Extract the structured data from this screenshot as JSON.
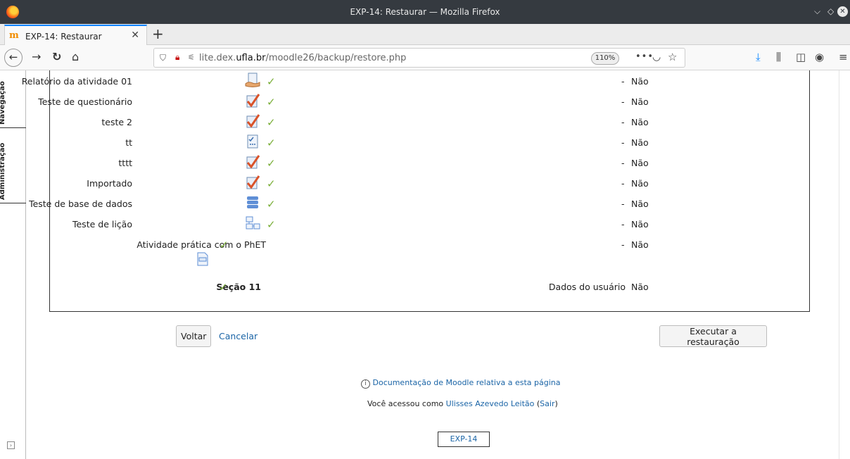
{
  "window": {
    "title": "EXP-14: Restaurar — Mozilla Firefox"
  },
  "browser": {
    "tab_title": "EXP-14: Restaurar",
    "tab_favicon": "m",
    "url_prefix": "lite.dex.",
    "url_domain": "ufla.br",
    "url_path": "/moodle26/backup/restore.php",
    "zoom": "110%"
  },
  "drawer": {
    "tabs": [
      "Navegação",
      "Administração"
    ]
  },
  "activities": [
    {
      "name": "Relatório da atividade 01",
      "icon": "assignment-icon",
      "included": true,
      "dash": "-",
      "value": "Não"
    },
    {
      "name": "Teste de questionário",
      "icon": "quiz-icon",
      "included": true,
      "dash": "-",
      "value": "Não"
    },
    {
      "name": "teste 2",
      "icon": "quiz-icon",
      "included": true,
      "dash": "-",
      "value": "Não"
    },
    {
      "name": "tt",
      "icon": "survey-icon",
      "included": true,
      "dash": "-",
      "value": "Não"
    },
    {
      "name": "tttt",
      "icon": "quiz-icon",
      "included": true,
      "dash": "-",
      "value": "Não"
    },
    {
      "name": "Importado",
      "icon": "quiz-icon",
      "included": true,
      "dash": "-",
      "value": "Não"
    },
    {
      "name": "Teste de base de dados",
      "icon": "database-icon",
      "included": true,
      "dash": "-",
      "value": "Não"
    },
    {
      "name": "Teste de lição",
      "icon": "lesson-icon",
      "included": true,
      "dash": "-",
      "value": "Não"
    },
    {
      "name": "Atividade prática com o PhET",
      "icon": "page-icon",
      "included": true,
      "dash": "-",
      "value": "Não"
    }
  ],
  "section": {
    "name": "Seção 11",
    "included": true,
    "user_data_label": "Dados do usuário",
    "value": "Não"
  },
  "actions": {
    "back": "Voltar",
    "cancel": "Cancelar",
    "execute": "Executar a restauração"
  },
  "footer": {
    "docs_link": "Documentação de Moodle relativa a esta página",
    "logged_in_prefix": "Você acessou como",
    "user_name": "Ulisses Azevedo Leitão",
    "logout": "Sair",
    "course_short": "EXP-14"
  }
}
